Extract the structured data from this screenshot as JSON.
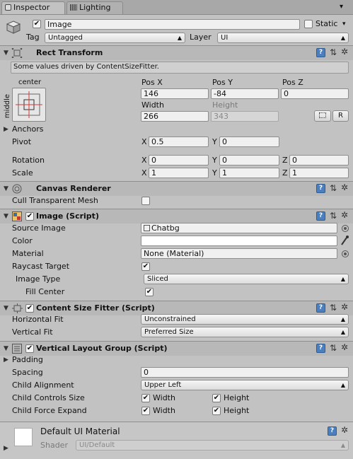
{
  "tabs": [
    {
      "label": "Inspector"
    },
    {
      "label": "Lighting"
    }
  ],
  "object": {
    "name": "Image",
    "active": true,
    "static_label": "Static",
    "static_checked": false,
    "tag_label": "Tag",
    "tag_value": "Untagged",
    "layer_label": "Layer",
    "layer_value": "UI"
  },
  "rect_transform": {
    "title": "Rect Transform",
    "info": "Some values driven by ContentSizeFitter.",
    "anchor_h": "center",
    "anchor_v": "middle",
    "pos_x_label": "Pos X",
    "pos_y_label": "Pos Y",
    "pos_z_label": "Pos Z",
    "pos_x": "146",
    "pos_y": "-84",
    "pos_z": "0",
    "width_label": "Width",
    "height_label": "Height",
    "width": "266",
    "height": "343",
    "blueprint_btn": "",
    "raw_btn": "R",
    "anchors_label": "Anchors",
    "pivot_label": "Pivot",
    "pivot_x": "0.5",
    "pivot_y": "0",
    "rotation_label": "Rotation",
    "rot_x": "0",
    "rot_y": "0",
    "rot_z": "0",
    "scale_label": "Scale",
    "scale_x": "1",
    "scale_y": "1",
    "scale_z": "1",
    "x": "X",
    "y": "Y",
    "z": "Z"
  },
  "canvas_renderer": {
    "title": "Canvas Renderer",
    "cull_label": "Cull Transparent Mesh",
    "cull_checked": false
  },
  "image_script": {
    "title": "Image (Script)",
    "enabled": true,
    "source_label": "Source Image",
    "source_value": "Chatbg",
    "color_label": "Color",
    "color_value": "#ffffff",
    "material_label": "Material",
    "material_value": "None (Material)",
    "raycast_label": "Raycast Target",
    "raycast_checked": true,
    "image_type_label": "Image Type",
    "image_type_value": "Sliced",
    "fill_center_label": "Fill Center",
    "fill_center_checked": true
  },
  "content_size_fitter": {
    "title": "Content Size Fitter (Script)",
    "enabled": true,
    "hfit_label": "Horizontal Fit",
    "hfit_value": "Unconstrained",
    "vfit_label": "Vertical Fit",
    "vfit_value": "Preferred Size"
  },
  "vertical_layout": {
    "title": "Vertical Layout Group (Script)",
    "enabled": true,
    "padding_label": "Padding",
    "spacing_label": "Spacing",
    "spacing_value": "0",
    "alignment_label": "Child Alignment",
    "alignment_value": "Upper Left",
    "controls_label": "Child Controls Size",
    "force_label": "Child Force Expand",
    "width_label": "Width",
    "height_label": "Height",
    "controls_width": true,
    "controls_height": true,
    "force_width": true,
    "force_height": true
  },
  "material_preview": {
    "name": "Default UI Material",
    "shader_label": "Shader",
    "shader_value": "UI/Default"
  },
  "check_glyph": "✔",
  "colors": {
    "panel_bg": "#c2c2c2",
    "header_bg": "#b4b4b4",
    "help_blue": "#4b7fbd",
    "anchor_red": "#d33b3b"
  }
}
